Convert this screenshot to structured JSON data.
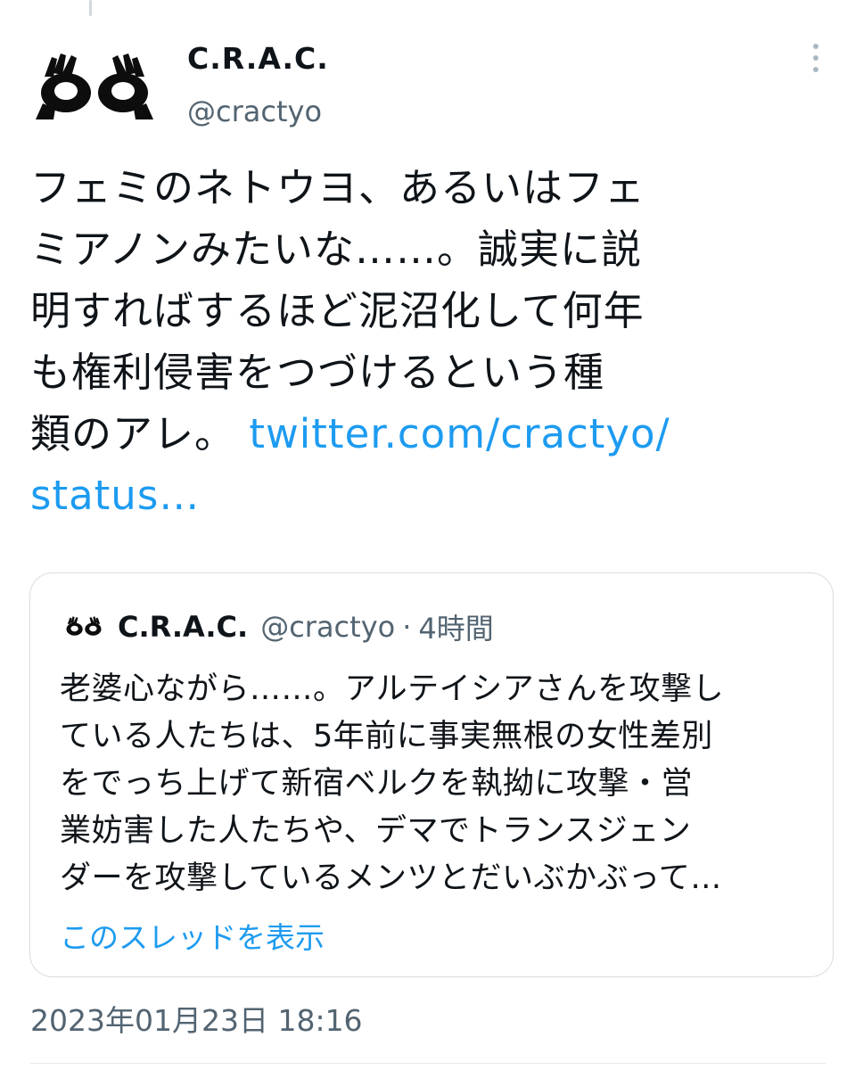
{
  "tweet": {
    "display_name": "C.R.A.C.",
    "handle": "@cractyo",
    "text_lines": [
      "フェミのネトウヨ、あるいはフェ",
      "ミアノンみたいな……。誠実に説",
      "明すればするほど泥沼化して何年",
      "も権利侵害をつづけるという種",
      "類のアレ。"
    ],
    "link_part1": "twitter.com/cractyo/",
    "link_part2": "status…",
    "timestamp": "2023年01月23日 18:16",
    "avatar_icon": "ok-hand-gesture-icon",
    "more_icon": "more-vertical-icon"
  },
  "quote": {
    "display_name": "C.R.A.C.",
    "handle": "@cractyo",
    "separator": "·",
    "time": "4時間",
    "text_lines": [
      "老婆心ながら……。アルテイシアさんを攻撃し",
      "ている人たちは、5年前に事実無根の女性差別",
      "をでっち上げて新宿ベルクを執拗に攻撃・営",
      "業妨害した人たちや、デマでトランスジェン",
      "ダーを攻撃しているメンツとだいぶかぶって…"
    ],
    "show_thread": "このスレッドを表示"
  },
  "colors": {
    "link": "#1d9bf0",
    "secondary_text": "#536471",
    "border": "#d7dde2"
  }
}
